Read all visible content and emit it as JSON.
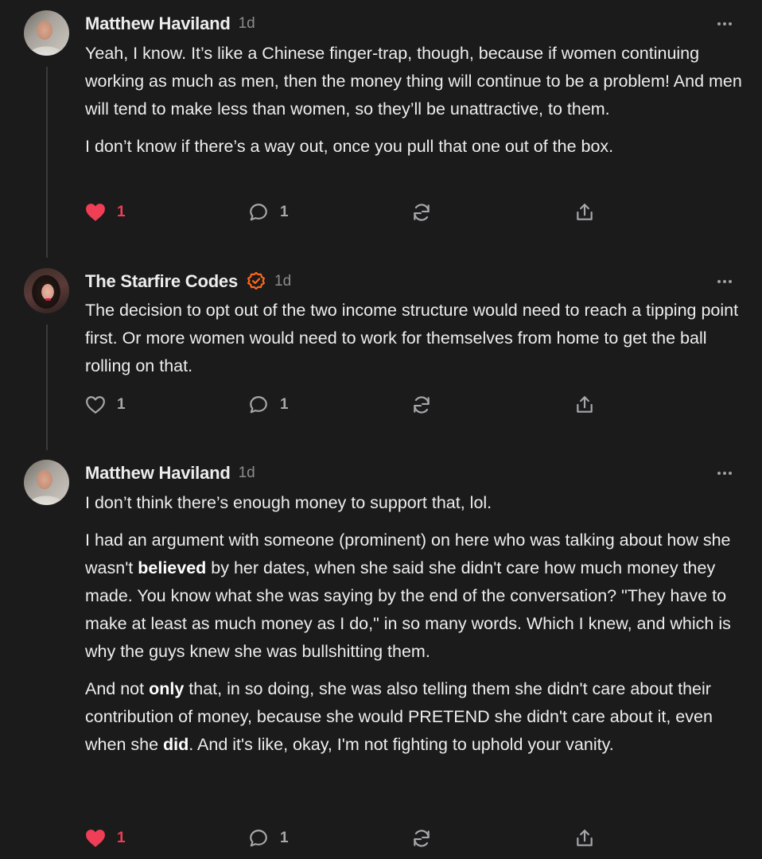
{
  "comments": [
    {
      "author": "Matthew Haviland",
      "time": "1d",
      "avatar_icon": "user-avatar",
      "paragraphs": [
        "Yeah, I know. It’s like a Chinese finger-trap, though, because if women continuing working as much as men, then the money thing will continue to be a problem! And men will tend to make less than women, so they’ll be unattractive, to them.",
        "I don’t know if there’s a way out, once you pull that one out of the box."
      ],
      "likes": "1",
      "liked": true,
      "replies": "1"
    },
    {
      "author": "The Starfire Codes",
      "time": "1d",
      "verified": true,
      "avatar_icon": "user-avatar",
      "paragraphs": [
        "The decision to opt out of the two income structure would need to reach a tipping point first. Or more women would need to work for themselves from home to get the ball rolling on that."
      ],
      "likes": "1",
      "liked": false,
      "replies": "1"
    },
    {
      "author": "Matthew Haviland",
      "time": "1d",
      "avatar_icon": "user-avatar",
      "paragraphs": [
        "I don’t think there’s enough money to support that, lol."
      ],
      "p2": {
        "a": "I had an argument with someone (prominent) on here who was talking about how she wasn't ",
        "b": "believed",
        "c": " by her dates, when she said she didn't care how much money they made. You know what she was saying by the end of the conversation? \"They have to make at least as much money as I do,\" in so many words. Which I knew, and which is why the guys knew she was bullshitting them."
      },
      "p3": {
        "a": "And not ",
        "b": "only",
        "c": " that, in so doing, she was also telling them she didn't care about their contribution of money, because she would PRETEND she didn't care about it, even when she ",
        "d": "did",
        "e": ". And it's like, okay, I'm not fighting to uphold your vanity."
      },
      "likes": "1",
      "liked": true,
      "replies": "1"
    }
  ],
  "colors": {
    "background": "#1b1b1c",
    "text": "#ededed",
    "muted": "#8c8c8f",
    "like": "#ef3e56",
    "verified": "#ff6719"
  },
  "icons": [
    "heart-icon",
    "comment-icon",
    "restack-icon",
    "share-icon",
    "more-icon",
    "verified-icon"
  ]
}
